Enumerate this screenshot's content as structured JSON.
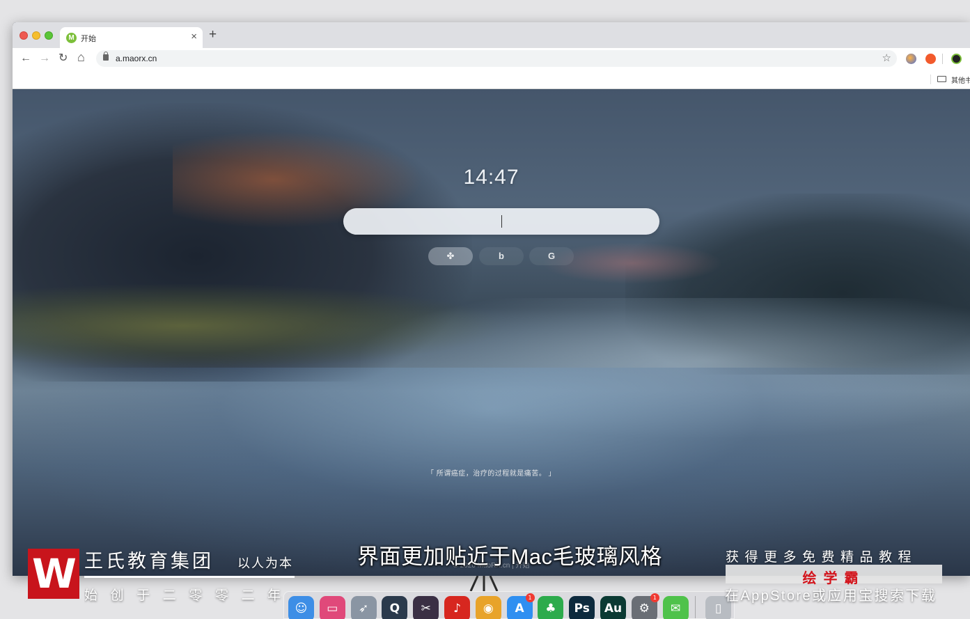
{
  "browser": {
    "tab": {
      "favicon_letter": "M",
      "title": "开始",
      "close": "×"
    },
    "new_tab": "+",
    "nav": {
      "back": "←",
      "forward": "→",
      "reload": "↻",
      "home": "⌂"
    },
    "url": "a.maorx.cn",
    "bookmark_star": "☆",
    "bookmarks_folder_label": "其他书签"
  },
  "page": {
    "clock": "14:47",
    "search_placeholder": "",
    "engines": [
      {
        "name": "baidu",
        "glyph": "✤"
      },
      {
        "name": "bing",
        "glyph": "b"
      },
      {
        "name": "google",
        "glyph": "G"
      }
    ],
    "quote": "「 所谓癌症，治疗的过程就是痛苦。 」",
    "copyright": "© 2020 MaoRX.cn  |  开始"
  },
  "dock": {
    "apps": [
      {
        "name": "finder",
        "glyph": "☺",
        "color": "#3d8ee6"
      },
      {
        "name": "cleanmymac",
        "glyph": "▭",
        "color": "#e0497a"
      },
      {
        "name": "launchpad",
        "glyph": "➶",
        "color": "#8a95a3"
      },
      {
        "name": "quicktime",
        "glyph": "Q",
        "color": "#2b3a4c"
      },
      {
        "name": "final-cut",
        "glyph": "✂",
        "color": "#3a2f44"
      },
      {
        "name": "netease-music",
        "glyph": "♪",
        "color": "#d7271f"
      },
      {
        "name": "chrome",
        "glyph": "◉",
        "color": "#e8a32a"
      },
      {
        "name": "app-store",
        "glyph": "A",
        "color": "#2f8ff1",
        "badge": "1"
      },
      {
        "name": "evernote",
        "glyph": "♣",
        "color": "#2dab4c"
      },
      {
        "name": "photoshop",
        "glyph": "Ps",
        "color": "#0d2a3d"
      },
      {
        "name": "audition",
        "glyph": "Au",
        "color": "#0b3a33"
      },
      {
        "name": "system-preferences",
        "glyph": "⚙",
        "color": "#6a6e75",
        "badge": "1"
      },
      {
        "name": "wechat",
        "glyph": "✉",
        "color": "#4fc24b"
      },
      {
        "name": "trash",
        "glyph": "▯",
        "color": "#b8bcc2"
      }
    ]
  },
  "overlay": {
    "logo_letter": "W",
    "brand_name": "王氏教育集团",
    "brand_motto": "以人为本",
    "brand_since": "始创于二零零二年",
    "subtitle": "界面更加贴近于Mac毛玻璃风格",
    "promo_top": "获得更多免费精品教程",
    "promo_app": "绘学霸",
    "promo_bottom": "在AppStore或应用宝搜索下载"
  }
}
